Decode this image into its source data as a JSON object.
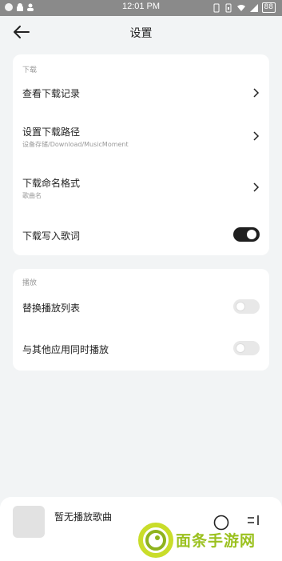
{
  "status_bar": {
    "time": "12:01 PM",
    "battery": "88",
    "left_icons": [
      "notification-icon",
      "android-icon",
      "contacts-icon"
    ],
    "right_icons": [
      "vibrate-icon",
      "portrait-lock-icon",
      "wifi-icon",
      "signal-icon",
      "battery-icon"
    ]
  },
  "header": {
    "title": "设置",
    "back_icon": "arrow-left-icon"
  },
  "download_section": {
    "label": "下载",
    "items": [
      {
        "label": "查看下载记录",
        "control": "chevron"
      },
      {
        "label": "设置下载路径",
        "sub": "设备存储/Download/MusicMoment",
        "control": "chevron"
      },
      {
        "label": "下载命名格式",
        "sub": "歌曲名",
        "control": "chevron"
      },
      {
        "label": "下载写入歌词",
        "control": "toggle",
        "value": true
      }
    ]
  },
  "playback_section": {
    "label": "播放",
    "items": [
      {
        "label": "替换播放列表",
        "control": "toggle",
        "value": false
      },
      {
        "label": "与其他应用同时播放",
        "control": "toggle",
        "value": false
      }
    ]
  },
  "player": {
    "now_playing": "暂无播放歌曲",
    "icons": [
      "play-circle-icon",
      "playlist-icon"
    ]
  },
  "watermark": {
    "text": "面条手游网"
  },
  "colors": {
    "background": "#f2f4f5",
    "toggle_on": "#1f1f1f",
    "toggle_off": "#e8e8e8",
    "watermark": "#9bc11f"
  }
}
